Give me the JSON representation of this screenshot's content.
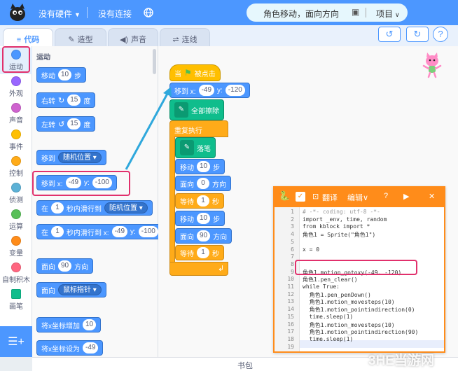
{
  "topbar": {
    "hardware": "没有硬件",
    "connection": "没有连接",
    "project_name": "角色移动，面向方向",
    "project_menu": "项目"
  },
  "tabs": [
    {
      "label": "代码",
      "icon": "code-icon"
    },
    {
      "label": "造型",
      "icon": "brush-icon"
    },
    {
      "label": "声音",
      "icon": "speaker-icon"
    },
    {
      "label": "连线",
      "icon": "link-icon"
    }
  ],
  "categories": [
    {
      "label": "运动",
      "color": "#4c97ff"
    },
    {
      "label": "外观",
      "color": "#9966ff"
    },
    {
      "label": "声音",
      "color": "#cf63cf"
    },
    {
      "label": "事件",
      "color": "#ffbf00"
    },
    {
      "label": "控制",
      "color": "#ffab19"
    },
    {
      "label": "侦测",
      "color": "#5cb1d6"
    },
    {
      "label": "运算",
      "color": "#59c059"
    },
    {
      "label": "变量",
      "color": "#ff8c1a"
    },
    {
      "label": "自制积木",
      "color": "#ff6680"
    },
    {
      "label": "画笔",
      "color": "#0fbd8c"
    }
  ],
  "palette": {
    "section": "运动",
    "move": {
      "label": "移动",
      "steps": "10",
      "unit": "步"
    },
    "turn_right": {
      "label": "右转",
      "deg": "15",
      "unit": "度"
    },
    "turn_left": {
      "label": "左转",
      "deg": "15",
      "unit": "度"
    },
    "goto_target": {
      "label": "移到",
      "target": "随机位置"
    },
    "goto_xy": {
      "label": "移到 x:",
      "x": "-49",
      "y_label": "y:",
      "y": "-100"
    },
    "glide_target": {
      "pre": "在",
      "secs": "1",
      "mid": "秒内滑行到",
      "target": "随机位置"
    },
    "glide_xy": {
      "pre": "在",
      "secs": "1",
      "mid": "秒内滑行到 x:",
      "x": "-49",
      "y_label": "y:",
      "y": "-100"
    },
    "point_dir": {
      "label": "面向",
      "deg": "90",
      "unit": "方向"
    },
    "point_towards": {
      "label": "面向",
      "target": "鼠标指针"
    },
    "change_x": {
      "label": "将x坐标增加",
      "val": "10"
    },
    "set_x": {
      "label": "将x坐标设为",
      "val": "-49"
    }
  },
  "script": {
    "hat": {
      "pre": "当",
      "post": "被点击"
    },
    "goto": {
      "label": "移到 x:",
      "x": "-49",
      "y_label": "y:",
      "y": "-120"
    },
    "clear": "全部擦除",
    "forever": "重复执行",
    "pen_down": "落笔",
    "move1": {
      "label": "移动",
      "val": "10",
      "unit": "步"
    },
    "dir1": {
      "label": "面向",
      "val": "0",
      "unit": "方向"
    },
    "wait1": {
      "label": "等待",
      "val": "1",
      "unit": "秒"
    },
    "move2": {
      "label": "移动",
      "val": "10",
      "unit": "步"
    },
    "dir2": {
      "label": "面向",
      "val": "90",
      "unit": "方向"
    },
    "wait2": {
      "label": "等待",
      "val": "1",
      "unit": "秒"
    }
  },
  "python_panel": {
    "translate": "翻译",
    "edit": "编辑",
    "lines": [
      {
        "n": "1",
        "text": "# -*- coding: utf-8 -*-"
      },
      {
        "n": "2",
        "text": "import _env, time, random"
      },
      {
        "n": "3",
        "text": "from kblock import *"
      },
      {
        "n": "4",
        "text": "角色1 = Sprite(\"角色1\")"
      },
      {
        "n": "5",
        "text": ""
      },
      {
        "n": "6",
        "text": "x = 0"
      },
      {
        "n": "7",
        "text": ""
      },
      {
        "n": "8",
        "text": ""
      },
      {
        "n": "9",
        "text": "角色1.motion_gotoxy(-49, -120)"
      },
      {
        "n": "10",
        "text": "角色1.pen_clear()"
      },
      {
        "n": "11",
        "text": "while True:"
      },
      {
        "n": "12",
        "text": "  角色1.pen_penDown()"
      },
      {
        "n": "13",
        "text": "  角色1.motion_movesteps(10)"
      },
      {
        "n": "14",
        "text": "  角色1.motion_pointindirection(0)"
      },
      {
        "n": "15",
        "text": "  time.sleep(1)"
      },
      {
        "n": "16",
        "text": "  角色1.motion_movesteps(10)"
      },
      {
        "n": "17",
        "text": "  角色1.motion_pointindirection(90)"
      },
      {
        "n": "18",
        "text": "  time.sleep(1)"
      },
      {
        "n": "19",
        "text": ""
      }
    ]
  },
  "bottom": {
    "backpack": "书包"
  },
  "watermark": "3HE当游网"
}
